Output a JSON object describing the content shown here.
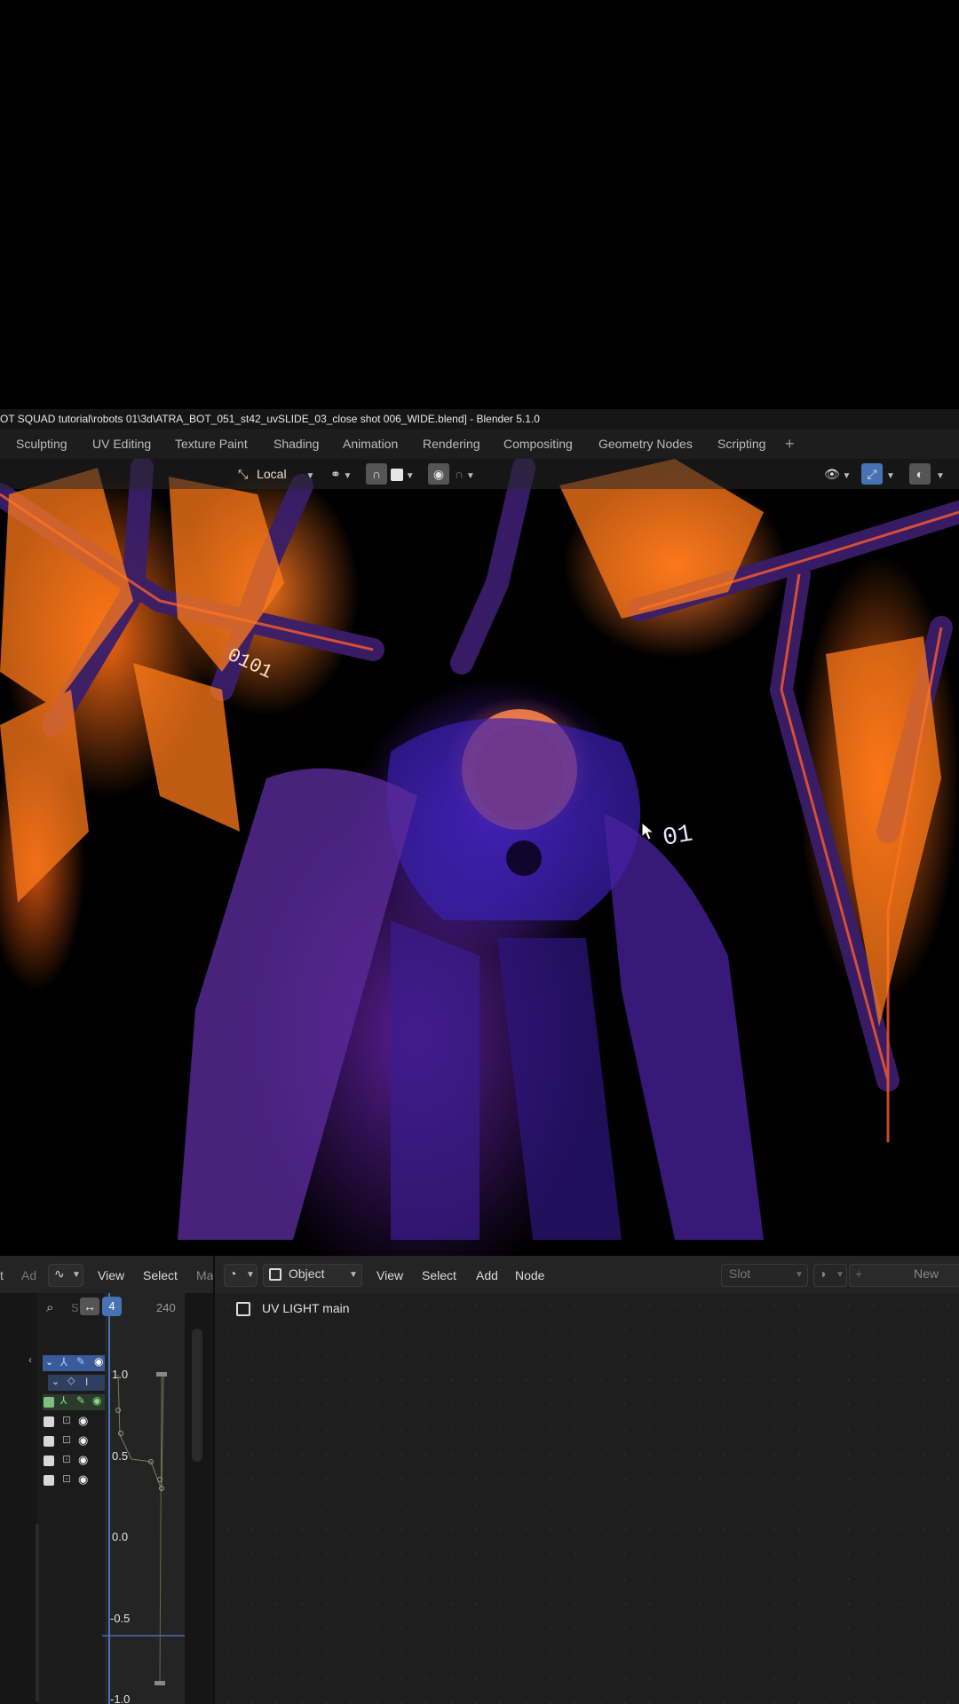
{
  "window": {
    "title": "OT SQUAD tutorial\\robots 01\\3d\\ATRA_BOT_051_st42_uvSLIDE_03_close shot 006_WIDE.blend] - Blender 5.1.0"
  },
  "workspace_tabs": [
    "Sculpting",
    "UV Editing",
    "Texture Paint",
    "Shading",
    "Animation",
    "Rendering",
    "Compositing",
    "Geometry Nodes",
    "Scripting",
    "+"
  ],
  "viewport_header": {
    "transform_orientation": "Local"
  },
  "viewport": {
    "decal_text_1": "0101",
    "decal_text_2": "01"
  },
  "graph_editor": {
    "header_left_clipped_1": "t",
    "header_left_clipped_2": "Ad",
    "menu_view": "View",
    "menu_select": "Select",
    "menu_clipped": "Ma",
    "search_placeholder": "S",
    "current_frame": "4",
    "end_frame": "240",
    "y_ticks": [
      "1.0",
      "0.5",
      "0.0",
      "-0.5",
      "-1.0"
    ],
    "channel_label_clipped": "I"
  },
  "node_editor": {
    "object_mode": "Object",
    "menu_view": "View",
    "menu_select": "Select",
    "menu_add": "Add",
    "menu_node": "Node",
    "slot_label": "Slot",
    "new_button": "New",
    "material_object_label": "UV LIGHT main"
  },
  "colors": {
    "accent_blue": "#4772b3",
    "panel_bg": "#1d1d1d",
    "header_bg": "#242424"
  }
}
